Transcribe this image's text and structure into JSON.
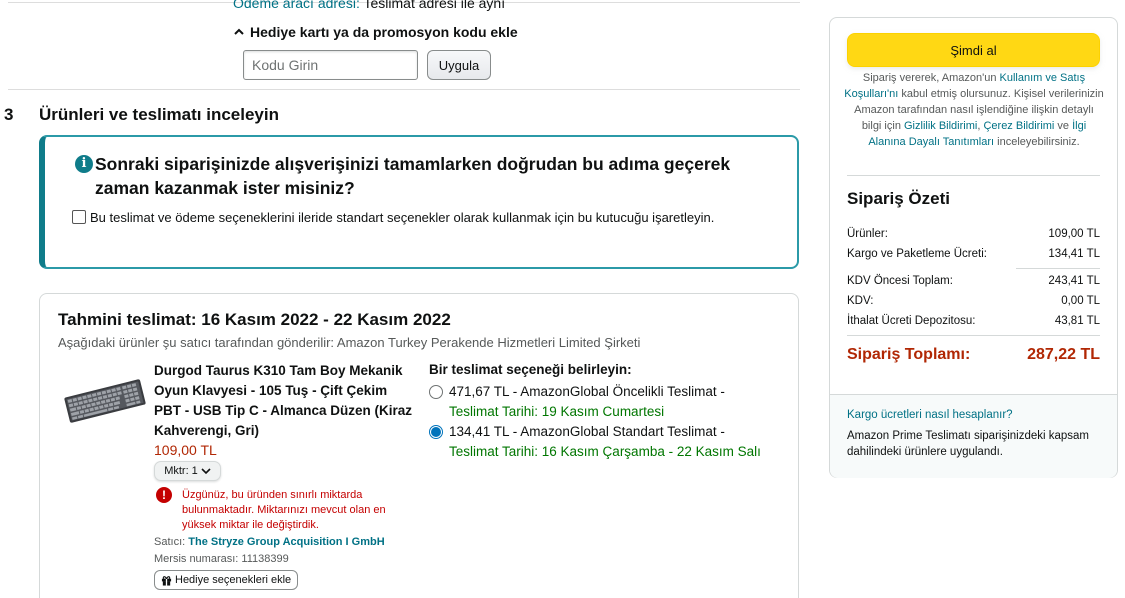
{
  "payment_address": {
    "label": "Ödeme aracı adresi:",
    "value": "Teslimat adresi ile aynı"
  },
  "promo": {
    "toggle_label": "Hediye kartı ya da promosyon kodu ekle",
    "input_placeholder": "Kodu Girin",
    "apply_label": "Uygula"
  },
  "step": {
    "number": "3",
    "title": "Ürünleri ve teslimatı inceleyin"
  },
  "info_box": {
    "heading": "Sonraki siparişinizde alışverişinizi tamamlarken doğrudan bu adıma geçerek zaman kazanmak ister misiniz?",
    "checkbox_label": "Bu teslimat ve ödeme seçeneklerini ileride standart seçenekler olarak kullanmak için bu kutucuğu işaretleyin.",
    "checked": false
  },
  "delivery": {
    "estimated": "Tahmini teslimat: 16 Kasım 2022 - 22 Kasım 2022",
    "shipped_by": "Aşağıdaki ürünler şu satıcı tarafından gönderilir: Amazon Turkey Perakende Hizmetleri Limited Şirketi"
  },
  "product": {
    "title": "Durgod Taurus K310 Tam Boy Mekanik Oyun Klavyesi - 105 Tuş - Çift Çekim PBT - USB Tip C - Almanca Düzen (Kiraz Kahverengi, Gri)",
    "price": "109,00 TL",
    "quantity_label": "Mktr: 1",
    "error": "Üzgünüz, bu üründen sınırlı miktarda bulunmaktadır. Miktarınızı mevcut olan en yüksek miktar ile değiştirdik.",
    "seller_label": "Satıcı:",
    "seller_name": "The Stryze Group Acquisition I GmbH",
    "mersis": "Mersis numarası: 11138399",
    "gift_label": "Hediye seçenekleri ekle"
  },
  "shipping": {
    "heading": "Bir teslimat seçeneği belirleyin:",
    "options": [
      {
        "label": "471,67 TL - AmazonGlobal Öncelikli Teslimat -",
        "date": "Teslimat Tarihi: 19 Kasım Cumartesi",
        "selected": false
      },
      {
        "label": "134,41 TL - AmazonGlobal Standart Teslimat -",
        "date": "Teslimat Tarihi: 16 Kasım Çarşamba - 22 Kasım Salı",
        "selected": true
      }
    ]
  },
  "sidebar": {
    "buy_label": "Şimdi al",
    "terms": {
      "t1": "Sipariş vererek, Amazon'un ",
      "l1": "Kullanım ve Satış Koşulları'nı",
      "t2": " kabul etmiş olursunuz. Kişisel verilerinizin Amazon tarafından nasıl işlendiğine ilişkin detaylı bilgi için ",
      "l2": "Gizlilik Bildirimi",
      "t3": ", ",
      "l3": "Çerez Bildirimi",
      "t4": " ve ",
      "l4": "İlgi Alanına Dayalı Tanıtımları",
      "t5": " inceleyebilirsiniz."
    },
    "summary_title": "Sipariş Özeti",
    "rows": [
      {
        "label": "Ürünler:",
        "value": "109,00 TL"
      },
      {
        "label": "Kargo ve Paketleme Ücreti:",
        "value": "134,41 TL"
      },
      {
        "label": "KDV Öncesi Toplam:",
        "value": "243,41 TL"
      },
      {
        "label": "KDV:",
        "value": "0,00 TL"
      },
      {
        "label": "İthalat Ücreti Depozitosu:",
        "value": "43,81 TL"
      }
    ],
    "total_label": "Sipariş Toplamı:",
    "total_value": "287,22 TL",
    "ship_calc_link": "Kargo ücretleri nasıl hesaplanır?",
    "prime_note": "Amazon Prime Teslimatı siparişinizdeki kapsam dahilindeki ürünlere uygulandı."
  },
  "colors": {
    "accent_teal": "#0f7c8a",
    "buy_yellow": "#ffd814",
    "price_red": "#b12704",
    "delivery_green": "#007600",
    "link": "#007185"
  }
}
